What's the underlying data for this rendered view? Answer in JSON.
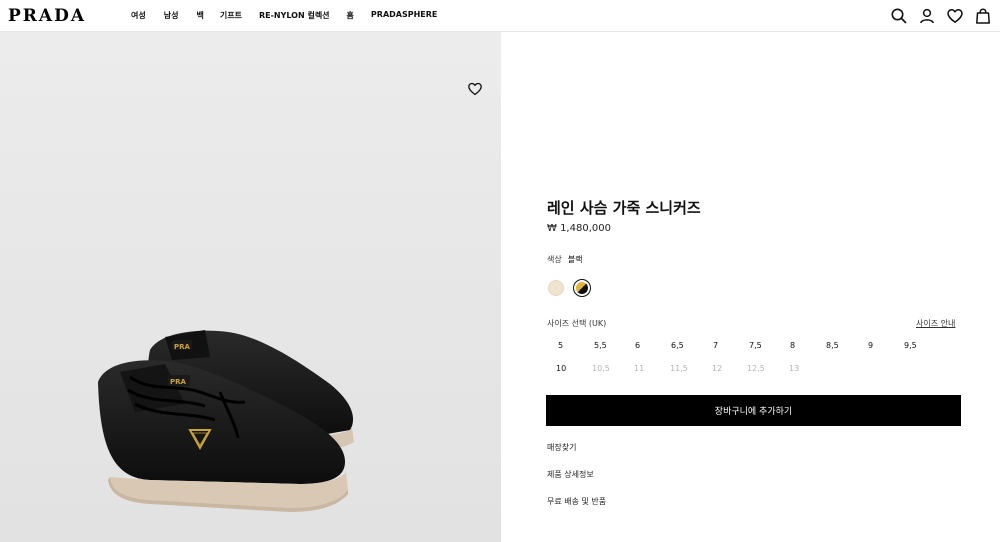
{
  "header": {
    "logo": "PRADA",
    "nav": [
      {
        "label": "여성"
      },
      {
        "label": "남성"
      },
      {
        "label": "백"
      },
      {
        "label": "기프트"
      },
      {
        "label": "RE-NYLON 컬렉션"
      },
      {
        "label": "홈"
      },
      {
        "label": "PRADASPHERE"
      }
    ],
    "icons": [
      "search-icon",
      "account-icon",
      "heart-icon",
      "bag-icon"
    ]
  },
  "product": {
    "title": "레인 사슴 가죽 스니커즈",
    "price": "₩ 1,480,000",
    "color_label": "색상",
    "color_value": "블랙",
    "swatches": [
      {
        "name": "cream",
        "color": "#efe4d0",
        "selected": false
      },
      {
        "name": "black-gold",
        "color": "#111111",
        "selected": true
      }
    ],
    "size_label": "사이즈 선택 (UK)",
    "size_guide": "사이즈 안내",
    "sizes": [
      {
        "label": "5",
        "available": true
      },
      {
        "label": "5,5",
        "available": true
      },
      {
        "label": "6",
        "available": true
      },
      {
        "label": "6,5",
        "available": true
      },
      {
        "label": "7",
        "available": true
      },
      {
        "label": "7,5",
        "available": true
      },
      {
        "label": "8",
        "available": true
      },
      {
        "label": "8,5",
        "available": true
      },
      {
        "label": "9",
        "available": true
      },
      {
        "label": "9,5",
        "available": true
      },
      {
        "label": "10",
        "available": true
      },
      {
        "label": "10,5",
        "available": false
      },
      {
        "label": "11",
        "available": false
      },
      {
        "label": "11,5",
        "available": false
      },
      {
        "label": "12",
        "available": false
      },
      {
        "label": "12,5",
        "available": false
      },
      {
        "label": "13",
        "available": false
      }
    ],
    "add_to_cart": "장바구니에 추가하기",
    "links": [
      {
        "label": "매장찾기"
      },
      {
        "label": "제품 상세정보"
      },
      {
        "label": "무료 배송 및 반품"
      }
    ]
  },
  "colors": {
    "accent": "#000000",
    "unavailable": "#b5b5b5",
    "image_bg": "#e8e8e8"
  }
}
